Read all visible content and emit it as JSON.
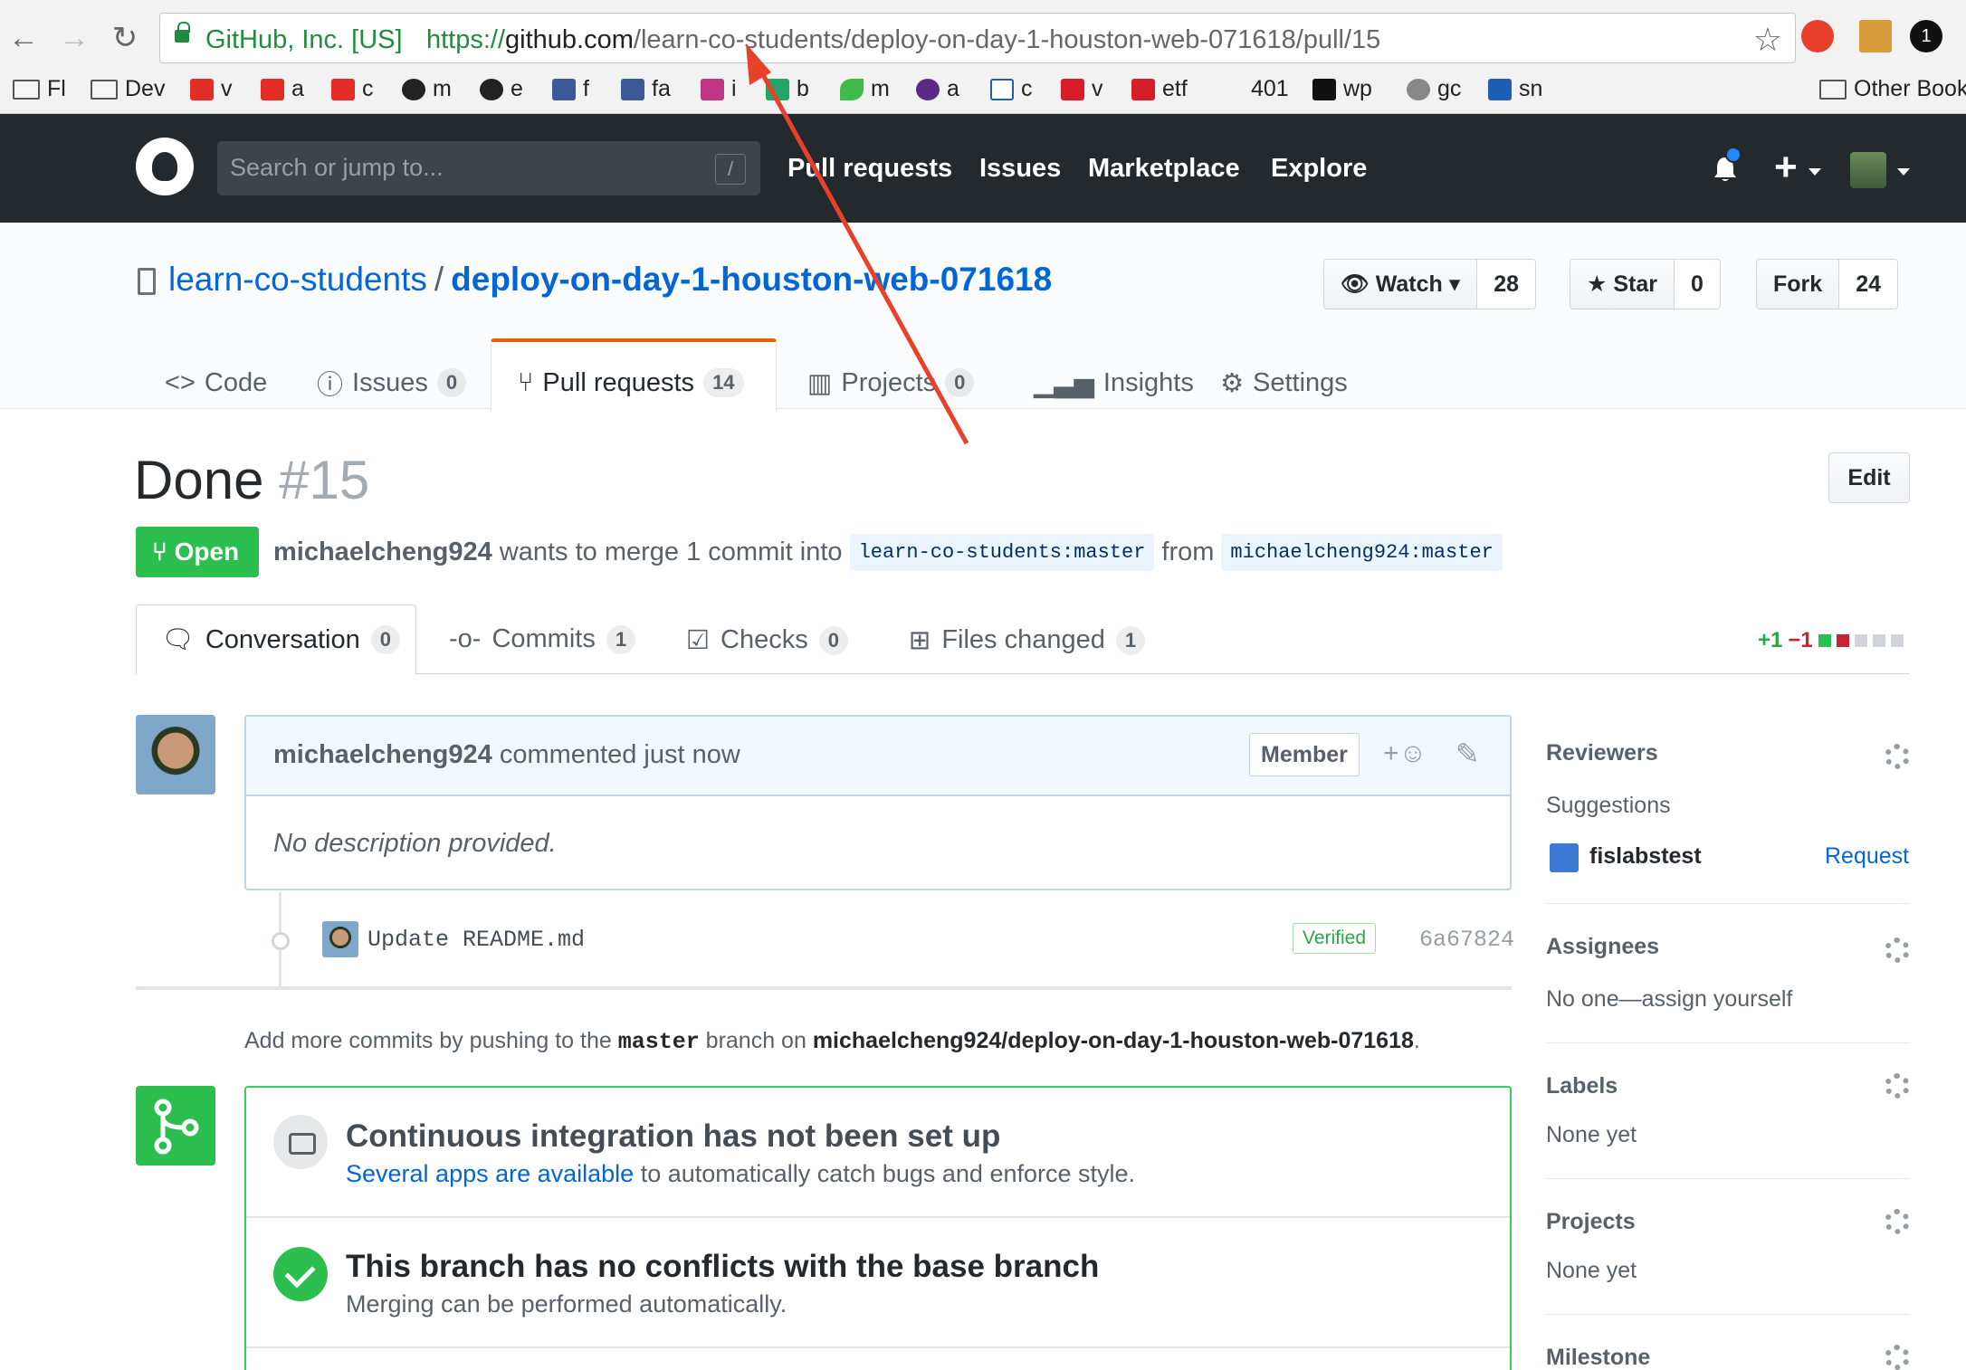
{
  "browser": {
    "url_origin": "GitHub, Inc. [US]",
    "url_scheme": "https://",
    "url_host": "github.com",
    "url_path": "/learn-co-students/deploy-on-day-1-houston-web-071618/pull/15",
    "bookmarks": [
      "Fl",
      "Dev",
      "v",
      "a",
      "c",
      "m",
      "e",
      "f",
      "fa",
      "i",
      "b",
      "m",
      "a",
      "c",
      "v",
      "etf",
      "401",
      "wp",
      "gc",
      "sn"
    ],
    "other_bookmarks": "Other Book",
    "ext_badge": "1"
  },
  "gh_header": {
    "search_placeholder": "Search or jump to...",
    "search_shortcut": "/",
    "nav": [
      "Pull requests",
      "Issues",
      "Marketplace",
      "Explore"
    ]
  },
  "repo": {
    "owner": "learn-co-students",
    "separator": "/",
    "name": "deploy-on-day-1-houston-web-071618",
    "watch_label": "Watch",
    "watch_count": "28",
    "star_label": "Star",
    "star_count": "0",
    "fork_label": "Fork",
    "fork_count": "24",
    "tabs": [
      {
        "label": "Code",
        "count": ""
      },
      {
        "label": "Issues",
        "count": "0"
      },
      {
        "label": "Pull requests",
        "count": "14"
      },
      {
        "label": "Projects",
        "count": "0"
      },
      {
        "label": "Insights",
        "count": ""
      },
      {
        "label": "Settings",
        "count": ""
      }
    ]
  },
  "pr": {
    "title": "Done",
    "number": "#15",
    "edit_label": "Edit",
    "state": "Open",
    "author": "michaelcheng924",
    "merge_text": "wants to merge 1 commit into",
    "base_branch": "learn-co-students:master",
    "from_text": "from",
    "head_branch": "michaelcheng924:master",
    "tabs": [
      {
        "label": "Conversation",
        "count": "0"
      },
      {
        "label": "Commits",
        "count": "1"
      },
      {
        "label": "Checks",
        "count": "0"
      },
      {
        "label": "Files changed",
        "count": "1"
      }
    ],
    "additions": "+1",
    "deletions": "−1"
  },
  "comment": {
    "author": "michaelcheng924",
    "action": "commented just now",
    "badge": "Member",
    "body": "No description provided."
  },
  "commit": {
    "message": "Update README.md",
    "verified": "Verified",
    "sha": "6a67824"
  },
  "push_hint": {
    "prefix": "Add more commits by pushing to the",
    "branch": "master",
    "middle": "branch on",
    "repo": "michaelcheng924/deploy-on-day-1-houston-web-071618",
    "suffix": "."
  },
  "merge": {
    "ci_title": "Continuous integration has not been set up",
    "ci_link": "Several apps are available",
    "ci_rest": "to automatically catch bugs and enforce style.",
    "ok_title": "This branch has no conflicts with the base branch",
    "ok_sub": "Merging can be performed automatically."
  },
  "sidebar": {
    "reviewers": "Reviewers",
    "suggestions": "Suggestions",
    "reviewer_name": "fislabstest",
    "request": "Request",
    "assignees": "Assignees",
    "assignees_value": "No one—assign yourself",
    "labels": "Labels",
    "labels_value": "None yet",
    "projects": "Projects",
    "projects_value": "None yet",
    "milestone": "Milestone"
  },
  "colors": {
    "accent_blue": "#0366d6",
    "open_green": "#2cbe4e",
    "tab_orange": "#e36209",
    "annotation_red": "#e8402a"
  }
}
